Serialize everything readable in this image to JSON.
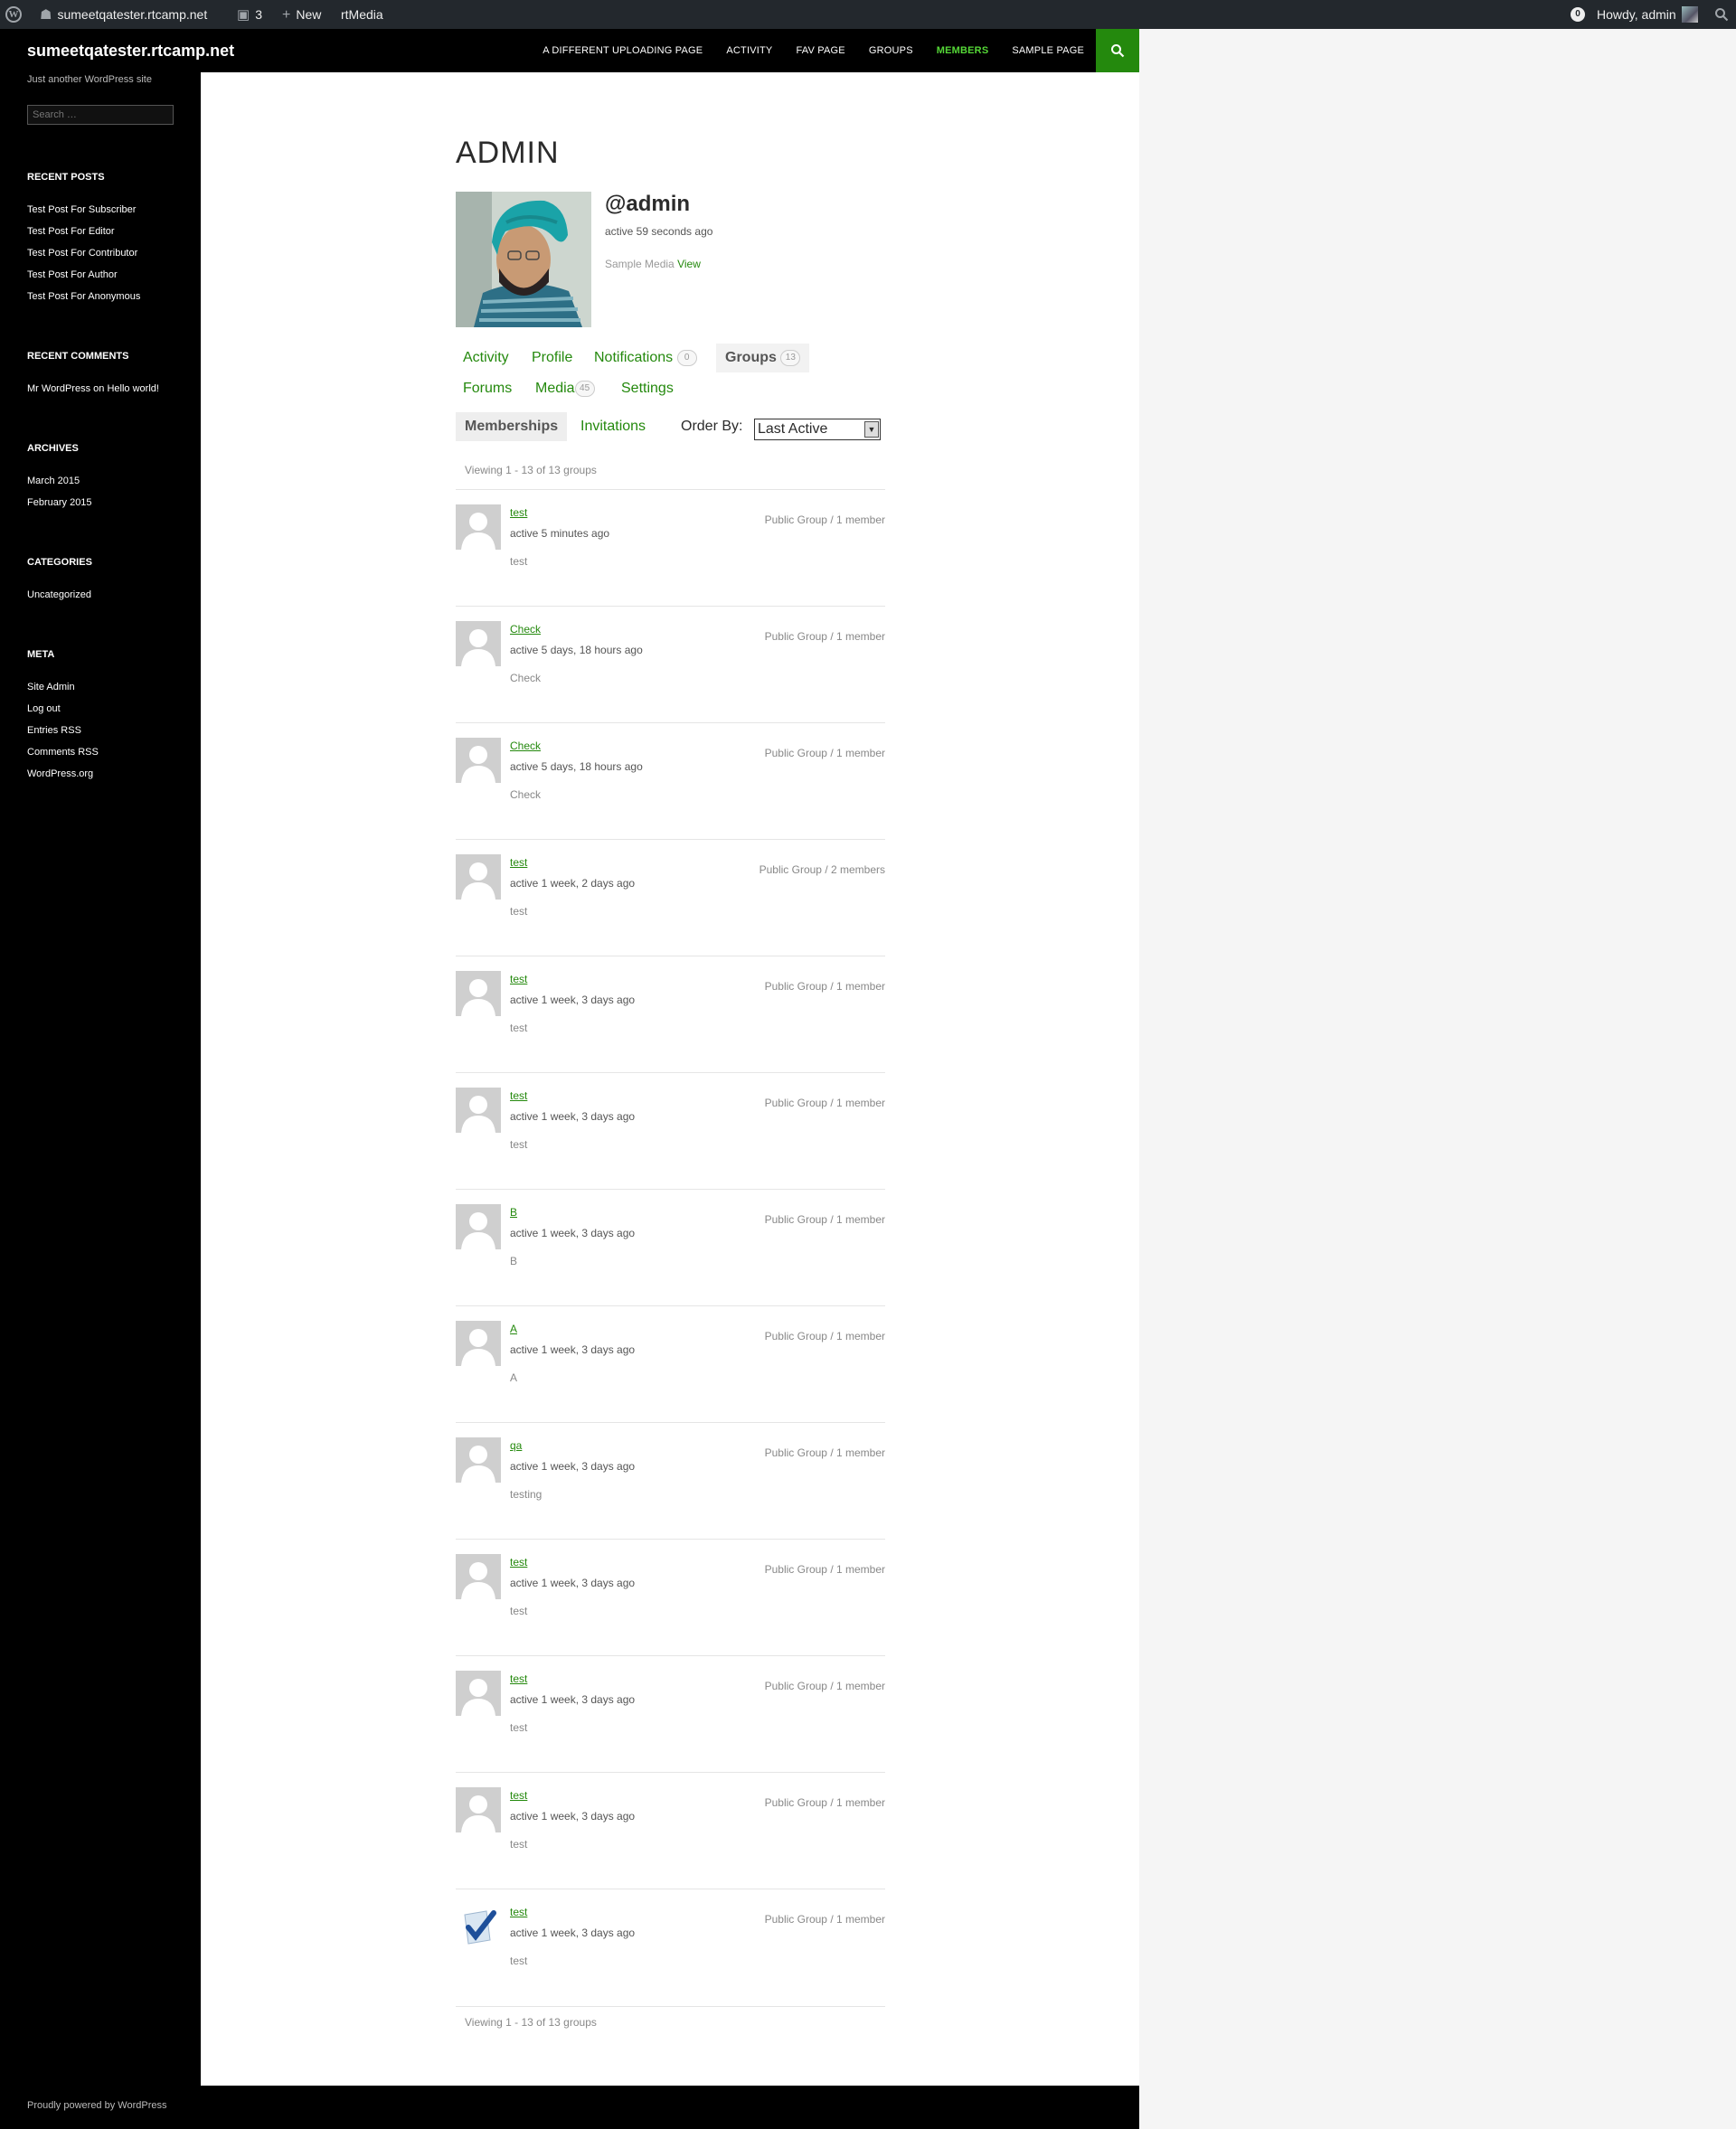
{
  "adminbar": {
    "site_name": "sumeetqatester.rtcamp.net",
    "comments_count": "3",
    "new_label": "New",
    "rtmedia_label": "rtMedia",
    "notifications_count": "0",
    "howdy": "Howdy, admin"
  },
  "header": {
    "site_title": "sumeetqatester.rtcamp.net",
    "nav": [
      "A DIFFERENT UPLOADING PAGE",
      "ACTIVITY",
      "FAV PAGE",
      "GROUPS",
      "MEMBERS",
      "SAMPLE PAGE"
    ],
    "current_nav": "MEMBERS"
  },
  "sidebar": {
    "description": "Just another WordPress site",
    "search_placeholder": "Search …",
    "recent_posts_title": "RECENT POSTS",
    "recent_posts": [
      "Test Post For Subscriber",
      "Test Post For Editor",
      "Test Post For Contributor",
      "Test Post For Author",
      "Test Post For Anonymous"
    ],
    "recent_comments_title": "RECENT COMMENTS",
    "recent_comment": {
      "author": "Mr WordPress",
      "on": "on",
      "post": "Hello world!"
    },
    "archives_title": "ARCHIVES",
    "archives": [
      "March 2015",
      "February 2015"
    ],
    "categories_title": "CATEGORIES",
    "categories": [
      "Uncategorized"
    ],
    "meta_title": "META",
    "meta": [
      "Site Admin",
      "Log out",
      "Entries RSS",
      "Comments RSS",
      "WordPress.org"
    ]
  },
  "profile": {
    "page_title": "ADMIN",
    "username": "@admin",
    "last_active": "active 59 seconds ago",
    "sample_media_label": "Sample Media",
    "sample_media_link": "View"
  },
  "tabs": {
    "activity": "Activity",
    "profile": "Profile",
    "notifications": "Notifications",
    "notifications_count": "0",
    "groups": "Groups",
    "groups_count": "13",
    "forums": "Forums",
    "media": "Media",
    "media_count": "45",
    "settings": "Settings"
  },
  "subnav": {
    "memberships": "Memberships",
    "invitations": "Invitations",
    "order_by_label": "Order By:",
    "order_by_value": "Last Active"
  },
  "pagination": "Viewing 1 - 13 of 13 groups",
  "groups": [
    {
      "name": "test",
      "active": "active 5 minutes ago",
      "desc": "test",
      "meta": "Public Group / 1 member"
    },
    {
      "name": "Check",
      "active": "active 5 days, 18 hours ago",
      "desc": "Check",
      "meta": "Public Group / 1 member"
    },
    {
      "name": "Check",
      "active": "active 5 days, 18 hours ago",
      "desc": "Check",
      "meta": "Public Group / 1 member"
    },
    {
      "name": "test",
      "active": "active 1 week, 2 days ago",
      "desc": "test",
      "meta": "Public Group / 2 members"
    },
    {
      "name": "test",
      "active": "active 1 week, 3 days ago",
      "desc": "test",
      "meta": "Public Group / 1 member"
    },
    {
      "name": "test",
      "active": "active 1 week, 3 days ago",
      "desc": "test",
      "meta": "Public Group / 1 member"
    },
    {
      "name": "B",
      "active": "active 1 week, 3 days ago",
      "desc": "B",
      "meta": "Public Group / 1 member"
    },
    {
      "name": "A",
      "active": "active 1 week, 3 days ago",
      "desc": "A",
      "meta": "Public Group / 1 member"
    },
    {
      "name": "qa",
      "active": "active 1 week, 3 days ago",
      "desc": "testing",
      "meta": "Public Group / 1 member"
    },
    {
      "name": "test",
      "active": "active 1 week, 3 days ago",
      "desc": "test",
      "meta": "Public Group / 1 member"
    },
    {
      "name": "test",
      "active": "active 1 week, 3 days ago",
      "desc": "test",
      "meta": "Public Group / 1 member"
    },
    {
      "name": "test",
      "active": "active 1 week, 3 days ago",
      "desc": "test",
      "meta": "Public Group / 1 member"
    },
    {
      "name": "test",
      "active": "active 1 week, 3 days ago",
      "desc": "test",
      "meta": "Public Group / 1 member",
      "avatar": "checkmark"
    }
  ],
  "footer": {
    "credit": "Proudly powered by WordPress"
  },
  "colors": {
    "accent": "#24890d",
    "nav_current": "#55d737",
    "adminbar": "#23282d"
  }
}
